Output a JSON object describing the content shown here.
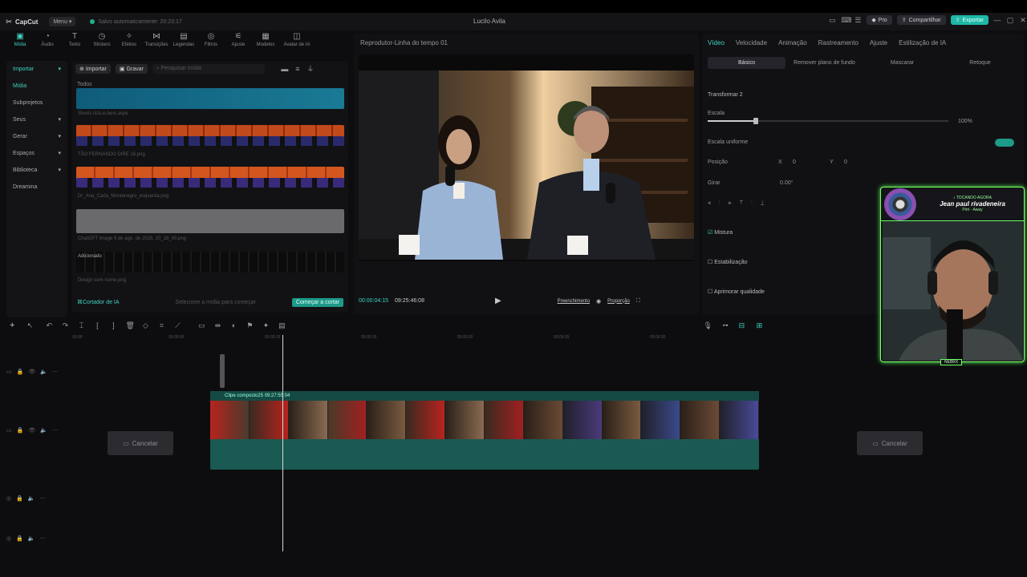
{
  "app": {
    "logo": "CapCut",
    "menu": "Menu",
    "saved": "Salvo automaticamente: 20:23:17",
    "title": "Lucilo Avila",
    "pro": "Pro",
    "share": "Compartilhar",
    "export": "Exportar"
  },
  "tools": [
    {
      "icon": "media-icon",
      "label": "Mídia"
    },
    {
      "icon": "audio-icon",
      "label": "Áudio"
    },
    {
      "icon": "text-icon",
      "label": "Texto"
    },
    {
      "icon": "stickers-icon",
      "label": "Stickers"
    },
    {
      "icon": "effects-icon",
      "label": "Efeitos"
    },
    {
      "icon": "transitions-icon",
      "label": "Transições"
    },
    {
      "icon": "captions-icon",
      "label": "Legendas"
    },
    {
      "icon": "filters-icon",
      "label": "Filtros"
    },
    {
      "icon": "adjust-icon",
      "label": "Ajuste"
    },
    {
      "icon": "models-icon",
      "label": "Modelos"
    },
    {
      "icon": "avatar-icon",
      "label": "Avatar de IA"
    }
  ],
  "sidebar": [
    "Importar",
    "Mídia",
    "Subprojetos",
    "Seus",
    "Gerar",
    "Espaços",
    "Biblioteca",
    "Dreamina"
  ],
  "media": {
    "import": "Importar",
    "record": "Gravar",
    "search_placeholder": "Pesquisar mídia",
    "section": "Todos",
    "captions": [
      "Shorts Isfa.io.best.aspe",
      "TÃO FERNANDO DIRE 16.png",
      "Dr_Ana_Carla_Montenegro_esquerda.png",
      "ChatGPT Image 9 de ago. de 2025, 20_18_00.png",
      "Design sem nome.png"
    ],
    "added": "Adicionado",
    "cutter": "Cortador de IA",
    "cutter_hint": "Selecione a mídia para começar",
    "cutter_btn": "Começar a cortar"
  },
  "player": {
    "title": "Reprodutor-Linha do tempo 01",
    "current": "00:00:04:15",
    "total": "09:25:46:08",
    "fill": "Preenchimento",
    "ratio": "Proporção"
  },
  "props": {
    "tabs": [
      "Vídeo",
      "Velocidade",
      "Animação",
      "Rastreamento",
      "Ajuste",
      "Estilização de IA"
    ],
    "subtabs": [
      "Básico",
      "Remover plano de fundo",
      "Mascarar",
      "Retoque"
    ],
    "transform": "Transformar 2",
    "scale": "Escala",
    "scale_val": "100%",
    "uniform": "Escala uniforme",
    "position": "Posição",
    "pos_x_label": "X",
    "pos_x": "0",
    "pos_y_label": "Y",
    "pos_y": "0",
    "rotate": "Girar",
    "rotate_val": "0.00°",
    "blend": "Mistura",
    "stabilize": "Estabilização",
    "enhance": "Aprimorar qualidade"
  },
  "timeline": {
    "clip": "Clipe composto25  09:27:55:04",
    "cancel": "Cancelar",
    "ruler": [
      "00:00",
      "00:00:05",
      "00:00:10",
      "00:00:15",
      "00:00:20",
      "00:00:25",
      "00:00:30"
    ]
  },
  "overlay": {
    "now_playing": "♪ TOCANDO AGORA",
    "song": "Jean paul rivadeneira",
    "sub": "Pirri - Away",
    "badge": "NEBRX"
  },
  "colors": {
    "accent": "#3fd4c0",
    "export": "#1fb7a6",
    "overlay_border": "#7cff66"
  }
}
